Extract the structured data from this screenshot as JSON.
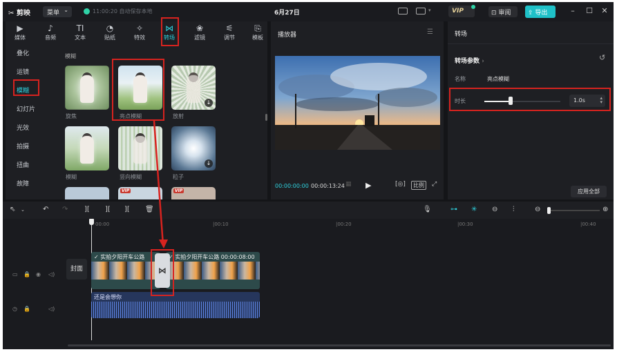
{
  "app": {
    "logo": "剪映",
    "menu_label": "菜单",
    "autosave_text": "11:00:20 自动保存本地",
    "date": "6月27日",
    "vip": "VIP",
    "review_label": "审阅",
    "export_label": "导出"
  },
  "toolbar_tabs": [
    {
      "label": "媒体",
      "icon": "▶"
    },
    {
      "label": "音频",
      "icon": "♪"
    },
    {
      "label": "文本",
      "icon": "TI"
    },
    {
      "label": "贴纸",
      "icon": "◔"
    },
    {
      "label": "特效",
      "icon": "✧"
    },
    {
      "label": "转场",
      "icon": "⋈"
    },
    {
      "label": "滤镜",
      "icon": "❀"
    },
    {
      "label": "调节",
      "icon": "⚟"
    },
    {
      "label": "模板",
      "icon": "⎘"
    }
  ],
  "categories": [
    "叠化",
    "运镜",
    "模糊",
    "幻灯片",
    "光效",
    "拍摄",
    "扭曲",
    "故障"
  ],
  "section_title": "模糊",
  "transitions": [
    {
      "label": "旋焦"
    },
    {
      "label": "亮点模糊"
    },
    {
      "label": "放射"
    },
    {
      "label": "模糊"
    },
    {
      "label": "竖向模糊"
    },
    {
      "label": "粒子"
    }
  ],
  "vip_tag": "VIP",
  "player": {
    "title": "播放器",
    "current_time": "00:00:00:00",
    "total_time": "00:00:13:24",
    "ratio_label": "比例"
  },
  "details": {
    "tab": "转场",
    "section": "转场参数",
    "name_label": "名称",
    "name_value": "亮点模糊",
    "duration_label": "时长",
    "duration_value": "1.0s",
    "duration_level": 0.3,
    "apply_all": "应用全部"
  },
  "timeline": {
    "ruler": [
      "00:00",
      "|00:10",
      "|00:20",
      "|00:30",
      "|00:40"
    ],
    "cover_label": "封面",
    "clip1_title": "实拍夕阳开车公路",
    "clip2_title": "实拍夕阳开车公路",
    "clip2_time": "00:00:08:00",
    "audio_title": "还是会想你"
  },
  "colors": {
    "accent": "#2fd3e0",
    "annotation": "#d8231f",
    "export": "#1fc1c8"
  }
}
